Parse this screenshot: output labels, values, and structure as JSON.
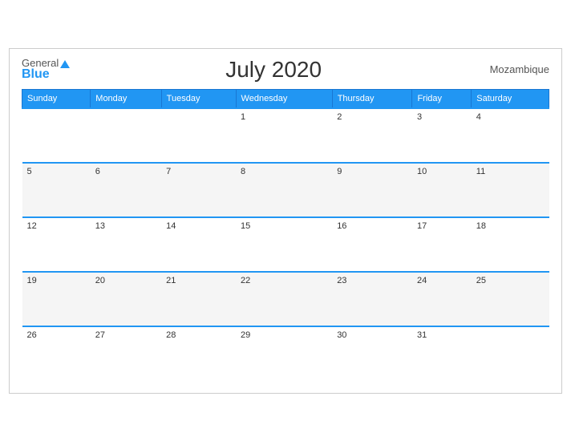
{
  "header": {
    "logo_general": "General",
    "logo_blue": "Blue",
    "title": "July 2020",
    "country": "Mozambique"
  },
  "weekdays": [
    "Sunday",
    "Monday",
    "Tuesday",
    "Wednesday",
    "Thursday",
    "Friday",
    "Saturday"
  ],
  "weeks": [
    [
      "",
      "",
      "",
      "1",
      "2",
      "3",
      "4"
    ],
    [
      "5",
      "6",
      "7",
      "8",
      "9",
      "10",
      "11"
    ],
    [
      "12",
      "13",
      "14",
      "15",
      "16",
      "17",
      "18"
    ],
    [
      "19",
      "20",
      "21",
      "22",
      "23",
      "24",
      "25"
    ],
    [
      "26",
      "27",
      "28",
      "29",
      "30",
      "31",
      ""
    ]
  ]
}
